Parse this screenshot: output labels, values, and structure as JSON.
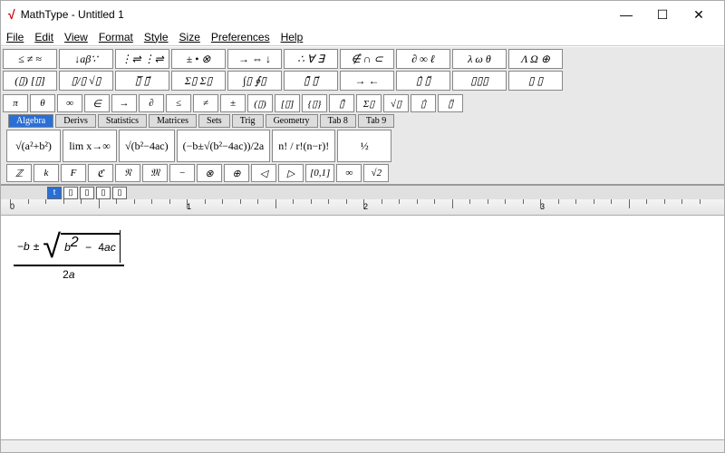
{
  "app": {
    "name": "MathType",
    "doc": "Untitled 1",
    "title": "MathType - Untitled 1"
  },
  "win": {
    "min": "—",
    "max": "☐",
    "close": "✕"
  },
  "menu": [
    "File",
    "Edit",
    "View",
    "Format",
    "Style",
    "Size",
    "Preferences",
    "Help"
  ],
  "palette_row1": [
    "≤ ≠ ≈",
    "↓aβ∵",
    "⋮⇌ ⋮⇌",
    "± • ⊗",
    "→ ⇔ ↓",
    "∴ ∀ ∃",
    "∉ ∩ ⊂",
    "∂ ∞ ℓ",
    "λ ω θ",
    "Λ Ω ⊕"
  ],
  "palette_row2": [
    "(▯) [▯]",
    "▯/▯ √▯",
    "▯̅ ▯⃗",
    "Σ▯ Σ▯",
    "∫▯ ∮▯",
    "▯̄ ▯⃗",
    "→ ←",
    "▯̇ ▯̈",
    "▯▯▯",
    "▯ ▯"
  ],
  "symrow": [
    "π",
    "θ",
    "∞",
    "∈",
    "→",
    "∂",
    "≤",
    "≠",
    "±",
    "(▯)",
    "[▯]",
    "{▯}",
    "▯̄",
    "Σ▯",
    "√▯",
    "▯̇",
    "▯̈"
  ],
  "tabs": [
    "Algebra",
    "Derivs",
    "Statistics",
    "Matrices",
    "Sets",
    "Trig",
    "Geometry",
    "Tab 8",
    "Tab 9"
  ],
  "active_tab": 0,
  "templates": [
    {
      "tex": "√(a²+b²)"
    },
    {
      "tex": "lim x→∞"
    },
    {
      "tex": "√(b²−4ac)"
    },
    {
      "tex": "(−b±√(b²−4ac))/2a"
    },
    {
      "tex": "n! / r!(n−r)!"
    },
    {
      "tex": "½"
    }
  ],
  "glyphrow": [
    "ℤ",
    "k",
    "F",
    "ℭ",
    "𝔑",
    "𝔐",
    "−",
    "⊗",
    "⊕",
    "◁",
    "▷",
    "[0,1]",
    "∞",
    "√2"
  ],
  "status_btns": [
    "t",
    "▯",
    "▯",
    "▯",
    "▯"
  ],
  "ruler": {
    "marks": [
      0,
      1,
      2,
      3
    ]
  },
  "equation": {
    "minus": "−",
    "b": "b",
    "pm": "±",
    "sqrt": "√",
    "b2": "b",
    "sq": "2",
    "minus2": "−",
    "four": "4",
    "a": "a",
    "c": "c",
    "two": "2",
    "a2": "a"
  }
}
